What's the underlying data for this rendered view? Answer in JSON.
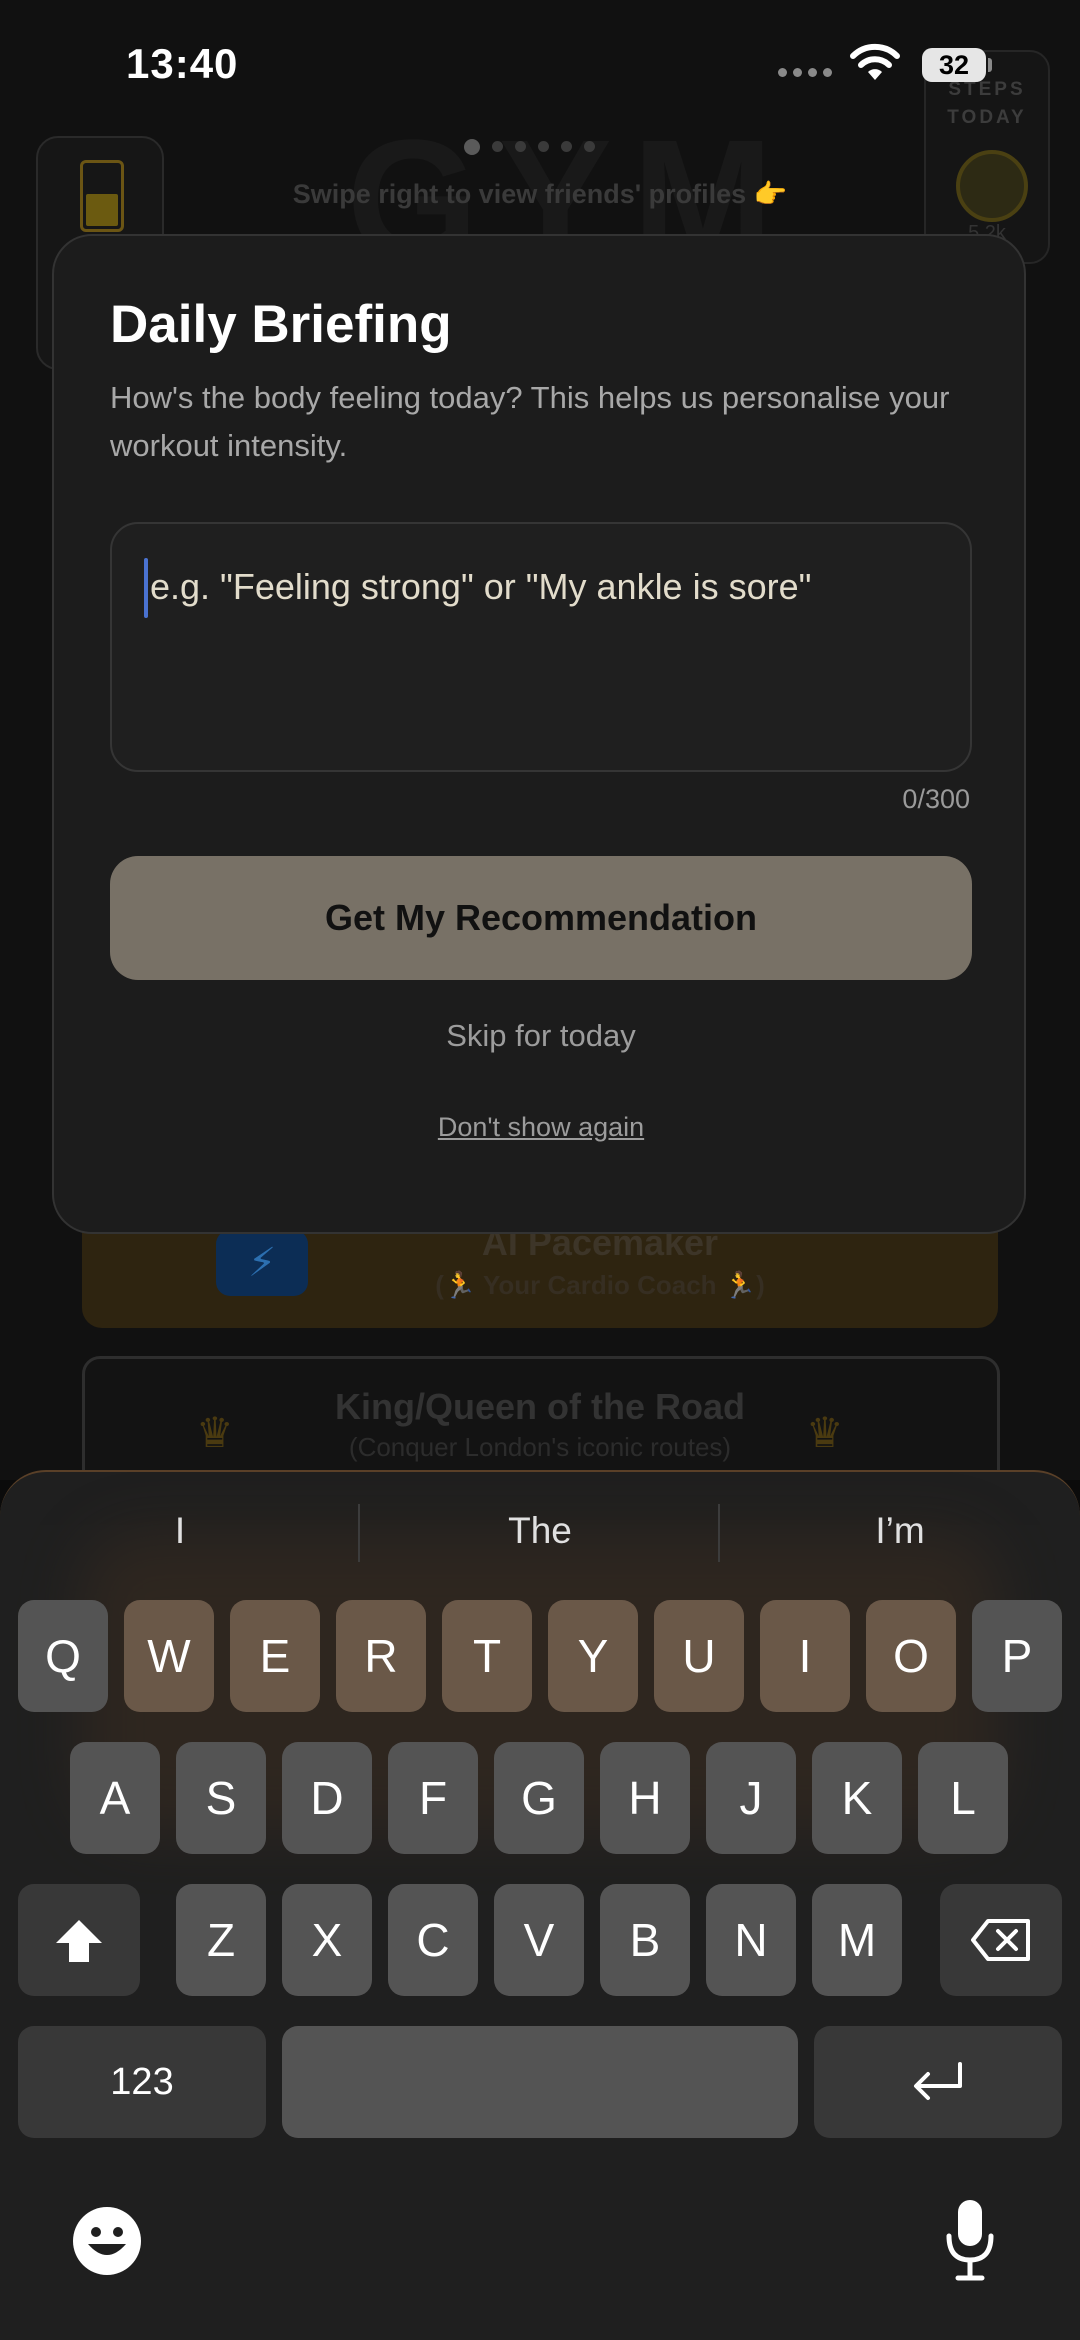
{
  "status_bar": {
    "time": "13:40",
    "battery": "32"
  },
  "background": {
    "logo": "GYM",
    "steps_label": "STEPS TODAY",
    "steps_value": "5.2k",
    "swipe_hint": "Swipe right to view friends' profiles 👉",
    "pacemaker_title": "AI Pacemaker",
    "pacemaker_subtitle": "(🏃 Your Cardio Coach 🏃)",
    "road_title": "King/Queen of the Road",
    "road_subtitle": "(Conquer London's iconic routes)",
    "crown_icon": "crown-icon"
  },
  "modal": {
    "title": "Daily Briefing",
    "subtitle": "How's the body feeling today? This helps us personalise your workout intensity.",
    "input_placeholder": "e.g. \"Feeling strong\" or \"My ankle is sore\"",
    "char_counter": "0/300",
    "cta_label": "Get My Recommendation",
    "skip_label": "Skip for today",
    "dont_show_label": "Don't show again"
  },
  "keyboard": {
    "suggestions": [
      "I",
      "The",
      "I’m"
    ],
    "row1": [
      "Q",
      "W",
      "E",
      "R",
      "T",
      "Y",
      "U",
      "I",
      "O",
      "P"
    ],
    "row2": [
      "A",
      "S",
      "D",
      "F",
      "G",
      "H",
      "J",
      "K",
      "L"
    ],
    "row3": [
      "Z",
      "X",
      "C",
      "V",
      "B",
      "N",
      "M"
    ],
    "numbers_label": "123",
    "icons": [
      "shift-icon",
      "backspace-icon",
      "return-icon",
      "emoji-icon",
      "microphone-icon"
    ]
  },
  "colors": {
    "modal_bg": "#1c1c1c",
    "cta_bg": "#787166",
    "caret": "#4a72d0",
    "keyboard_bg": "#1f1f1f",
    "key_bg": "#545454"
  }
}
